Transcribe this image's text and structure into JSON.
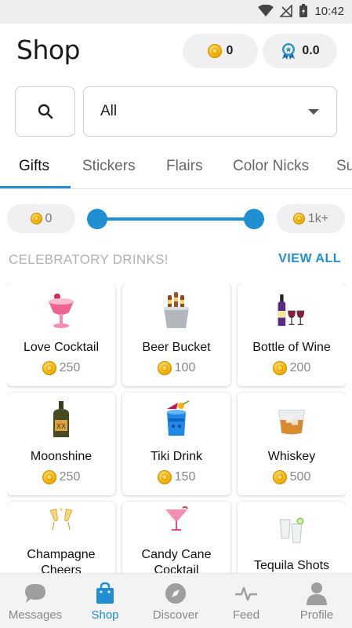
{
  "status_bar": {
    "time": "10:42"
  },
  "header": {
    "title": "Shop",
    "coin_balance": "0",
    "rating": "0.0"
  },
  "search": {
    "icon": "search-icon"
  },
  "category_select": {
    "value": "All"
  },
  "tabs": [
    {
      "label": "Gifts",
      "active": true
    },
    {
      "label": "Stickers"
    },
    {
      "label": "Flairs"
    },
    {
      "label": "Color Nicks"
    },
    {
      "label": "Su"
    }
  ],
  "price_range": {
    "min_label": "0",
    "max_label": "1k+",
    "min_fraction": 0.0,
    "max_fraction": 1.0
  },
  "section": {
    "title": "CELEBRATORY DRINKS!",
    "view_all": "VIEW ALL"
  },
  "items": [
    {
      "name": "Love Cocktail",
      "price": "250",
      "icon": "pink-cocktail-icon"
    },
    {
      "name": "Beer Bucket",
      "price": "100",
      "icon": "beer-bucket-icon"
    },
    {
      "name": "Bottle of Wine",
      "price": "200",
      "icon": "wine-bottle-icon"
    },
    {
      "name": "Moonshine",
      "price": "250",
      "icon": "moonshine-jug-icon"
    },
    {
      "name": "Tiki Drink",
      "price": "150",
      "icon": "tiki-drink-icon"
    },
    {
      "name": "Whiskey",
      "price": "500",
      "icon": "whiskey-glass-icon"
    },
    {
      "name": "Champagne Cheers",
      "price": "",
      "icon": "champagne-glasses-icon"
    },
    {
      "name": "Candy Cane Cocktail",
      "price": "",
      "icon": "candy-cane-cocktail-icon"
    },
    {
      "name": "Tequila Shots",
      "price": "",
      "icon": "tequila-shots-icon"
    }
  ],
  "bottom_nav": [
    {
      "label": "Messages",
      "icon": "chat-bubble-icon"
    },
    {
      "label": "Shop",
      "icon": "shopping-bag-icon",
      "active": true
    },
    {
      "label": "Discover",
      "icon": "compass-icon"
    },
    {
      "label": "Feed",
      "icon": "pulse-icon"
    },
    {
      "label": "Profile",
      "icon": "person-icon"
    }
  ],
  "colors": {
    "accent": "#1f8fd1",
    "coin": "#f4b400",
    "pill_bg": "#f0f0f2"
  }
}
